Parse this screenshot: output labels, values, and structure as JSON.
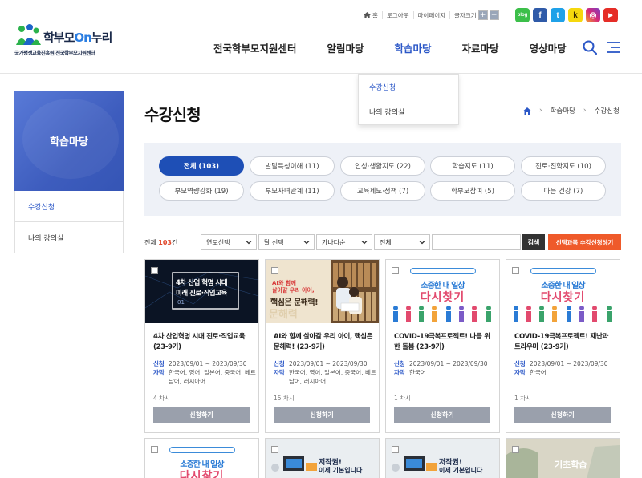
{
  "logo": {
    "name_a": "학부모",
    "name_b": "On",
    "name_c": "누리",
    "sub": "국가평생교육진흥원 전국학부모지원센터"
  },
  "util": {
    "home": "홈",
    "logout": "로그아웃",
    "mypage": "마이페이지",
    "font_size": "글자크기",
    "font_plus": "+",
    "font_minus": "−"
  },
  "sns": {
    "blog": "blog",
    "facebook": "f",
    "twitter": "t",
    "kakao": "k",
    "instagram": "◎",
    "youtube": "▶"
  },
  "gnb": [
    "전국학부모지원센터",
    "알림마당",
    "학습마당",
    "자료마당",
    "영상마당"
  ],
  "dropdown": [
    "수강신청",
    "나의 강의실"
  ],
  "lnb": {
    "title": "학습마당",
    "items": [
      "수강신청",
      "나의 강의실"
    ]
  },
  "page_title": "수강신청",
  "breadcrumb": [
    "학습마당",
    "수강신청"
  ],
  "categories": [
    "전체 (103)",
    "발달특성이해 (11)",
    "인성·생활지도 (22)",
    "학습지도 (11)",
    "진로·진학지도 (10)",
    "부모역량강화 (19)",
    "부모자녀관계 (11)",
    "교육제도·정책 (7)",
    "학부모참여 (5)",
    "마음 건강 (7)"
  ],
  "toolbar": {
    "total_prefix": "전체",
    "total_count": "103",
    "total_suffix": "건",
    "year": "연도선택",
    "month": "달 선택",
    "sort": "가나다순",
    "scope": "전체",
    "keyword": "",
    "search": "검색",
    "apply_selected": "선택과목 수강신청하기"
  },
  "card_labels": {
    "apply_key": "신청",
    "subtitle_key": "자막",
    "apply_button": "신청하기"
  },
  "cards": [
    {
      "title": "4차 산업혁명 시대 진로·직업교육 (23-9기)",
      "period": "2023/09/01 ~ 2023/09/30",
      "subtitle": "한국어, 영어, 일본어, 중국어, 베트남어, 러시아어",
      "round": "4 차시",
      "thumb_a": "4차 산업 혁명 시대",
      "thumb_b": "미래 진로·직업교육",
      "thumb_c": "01"
    },
    {
      "title": "AI와 함께 살아갈 우리 아이, 핵심은 문해력! (23-9기)",
      "period": "2023/09/01 ~ 2023/09/30",
      "subtitle": "한국어, 영어, 일본어, 중국어, 베트남어, 러시아어",
      "round": "15 차시",
      "thumb_a": "AI와 함께",
      "thumb_b": "살아갈 우리 아이,",
      "thumb_c": "핵심은 문해력!"
    },
    {
      "title": "COVID-19극복프로젝트! 나를 위한 돌봄 (23-9기)",
      "period": "2023/09/01 ~ 2023/09/30",
      "subtitle": "한국어",
      "round": "1 차시",
      "thumb_a": "소중한 내 일상",
      "thumb_b": "다시찾기"
    },
    {
      "title": "COVID-19극복프로젝트! 재난과 트라우마 (23-9기)",
      "period": "2023/09/01 ~ 2023/09/30",
      "subtitle": "한국어",
      "round": "1 차시",
      "thumb_a": "소중한 내 일상",
      "thumb_b": "다시찾기"
    }
  ],
  "cards_row2": [
    {
      "thumb_a": "소중한 내 일상",
      "thumb_b": "다시찾기"
    },
    {
      "thumb_a": "저작권!",
      "thumb_b": "이제 기본입니다"
    },
    {
      "thumb_a": "저작권!",
      "thumb_b": "이제 기본입니다"
    },
    {
      "thumb_a": "기초학습"
    }
  ],
  "colors": {
    "brand_blue": "#1e4fb6",
    "accent_orange": "#ef5a2a",
    "active_nav": "#2b57c7",
    "count_red": "#e0462a"
  }
}
